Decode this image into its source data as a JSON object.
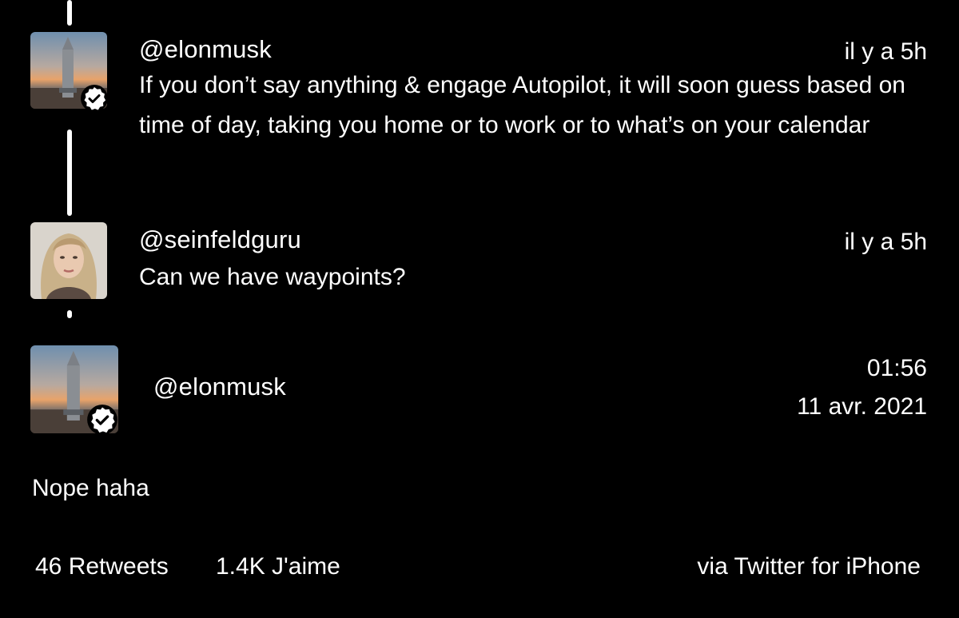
{
  "thread": [
    {
      "username": "@elonmusk",
      "time": "il y a 5h",
      "text": "If you don’t say anything & engage Autopilot, it will soon guess based on time of day, taking you home or to work or to what’s on your calendar",
      "verified": true,
      "avatar_icon": "starship-avatar"
    },
    {
      "username": "@seinfeldguru",
      "time": "il y a 5h",
      "text": "Can we have waypoints?",
      "verified": false,
      "avatar_icon": "woman-portrait-avatar"
    }
  ],
  "main_tweet": {
    "username": "@elonmusk",
    "time": "01:56",
    "date": "11 avr. 2021",
    "text": "Nope haha",
    "verified": true,
    "avatar_icon": "starship-avatar"
  },
  "stats": {
    "retweets": "46 Retweets",
    "likes": "1.4K J'aime",
    "source": "via Twitter for iPhone"
  },
  "colors": {
    "background": "#000000",
    "text": "#ffffff"
  }
}
